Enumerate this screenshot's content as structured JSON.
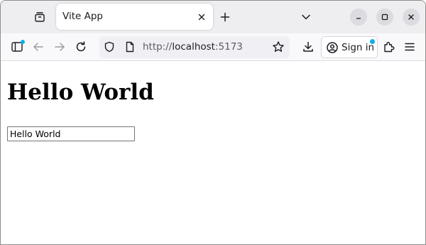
{
  "browser": {
    "tab": {
      "title": "Vite App"
    },
    "address_bar": {
      "scheme": "http://",
      "host": "localhost",
      "port": ":5173"
    },
    "account": {
      "sign_in_label": "Sign in"
    },
    "accent_color": "#0db0e6",
    "icons": [
      "tab-overview-icon",
      "close-icon",
      "plus-icon",
      "chevron-down-icon",
      "minimize-icon",
      "maximize-icon",
      "close-icon",
      "sidebar-icon",
      "arrow-left-icon",
      "arrow-right-icon",
      "reload-icon",
      "shield-icon",
      "page-icon",
      "star-icon",
      "download-icon",
      "account-icon",
      "extensions-icon",
      "hamburger-menu-icon"
    ]
  },
  "page": {
    "heading": "Hello World",
    "input": {
      "value": "Hello World"
    }
  }
}
